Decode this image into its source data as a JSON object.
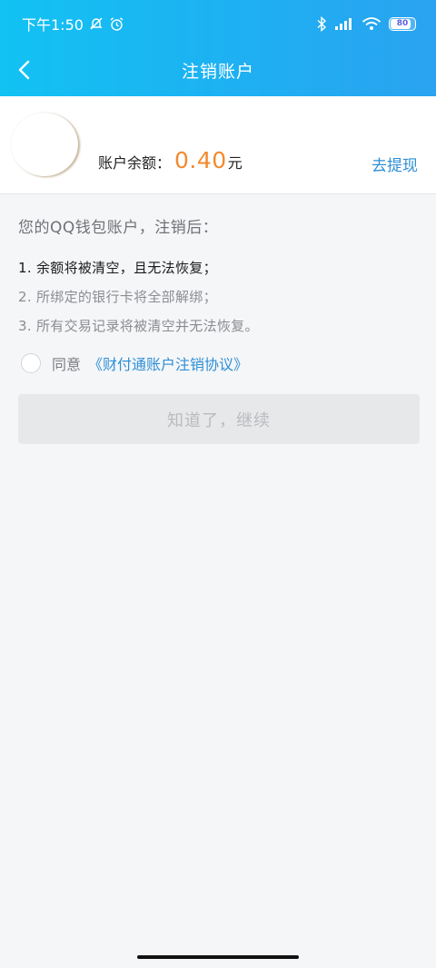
{
  "status_bar": {
    "time": "下午1:50",
    "battery": "80"
  },
  "nav": {
    "title": "注销账户"
  },
  "account": {
    "balance_label": "账户余额：",
    "balance_amount": "0.40",
    "balance_unit": "元",
    "withdraw_label": "去提现"
  },
  "notice": {
    "intro": "您的QQ钱包账户，注销后：",
    "items": [
      "1. 余额将被清空，且无法恢复；",
      "2. 所绑定的银行卡将全部解绑；",
      "3. 所有交易记录将被清空并无法恢复。"
    ]
  },
  "agreement": {
    "agree_label": "同意",
    "link_label": "《财付通账户注销协议》"
  },
  "actions": {
    "continue_label": "知道了，继续"
  },
  "colors": {
    "header_start": "#12c2f3",
    "header_end": "#2aa3f0",
    "amount": "#f28a2e",
    "link": "#2d8fd6",
    "disabled_button": "#e7e8ea"
  }
}
